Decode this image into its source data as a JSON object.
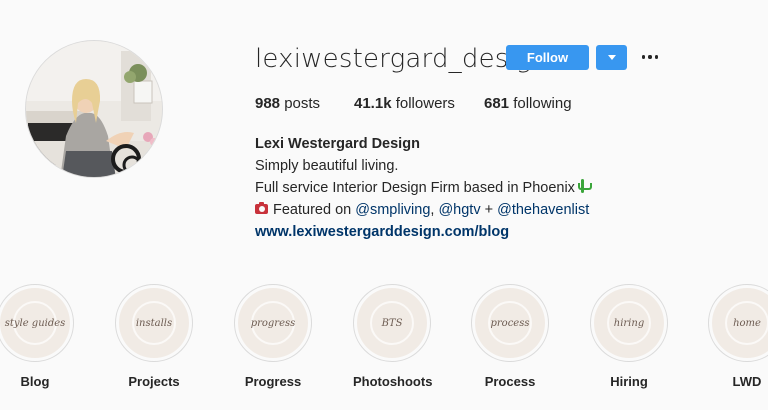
{
  "profile": {
    "username": "lexiwestergard_design",
    "follow_label": "Follow"
  },
  "stats": {
    "posts_count": "988",
    "posts_label": "posts",
    "followers_count": "41.1k",
    "followers_label": "followers",
    "following_count": "681",
    "following_label": "following"
  },
  "bio": {
    "name": "Lexi Westergard Design",
    "line1": "Simply beautiful living.",
    "line2": "Full service Interior Design Firm based in Phoenix",
    "featured_prefix": "Featured on",
    "mention1": "@smpliving",
    "mention2": "@hgtv",
    "plus": "+",
    "mention3": "@thehavenlist",
    "website": "www.lexiwestergarddesign.com/blog"
  },
  "highlights": [
    {
      "cover_text": "style guides",
      "label": "Blog"
    },
    {
      "cover_text": "installs",
      "label": "Projects"
    },
    {
      "cover_text": "progress",
      "label": "Progress"
    },
    {
      "cover_text": "BTS",
      "label": "Photoshoots"
    },
    {
      "cover_text": "process",
      "label": "Process"
    },
    {
      "cover_text": "hiring",
      "label": "Hiring"
    },
    {
      "cover_text": "home",
      "label": "LWD"
    }
  ],
  "colors": {
    "accent": "#3897f0",
    "link": "#003569",
    "highlight_bg": "#f1ebe5"
  },
  "icons": [
    "dropdown-caret-icon",
    "more-options-icon",
    "cactus-emoji-icon",
    "camera-emoji-icon"
  ]
}
